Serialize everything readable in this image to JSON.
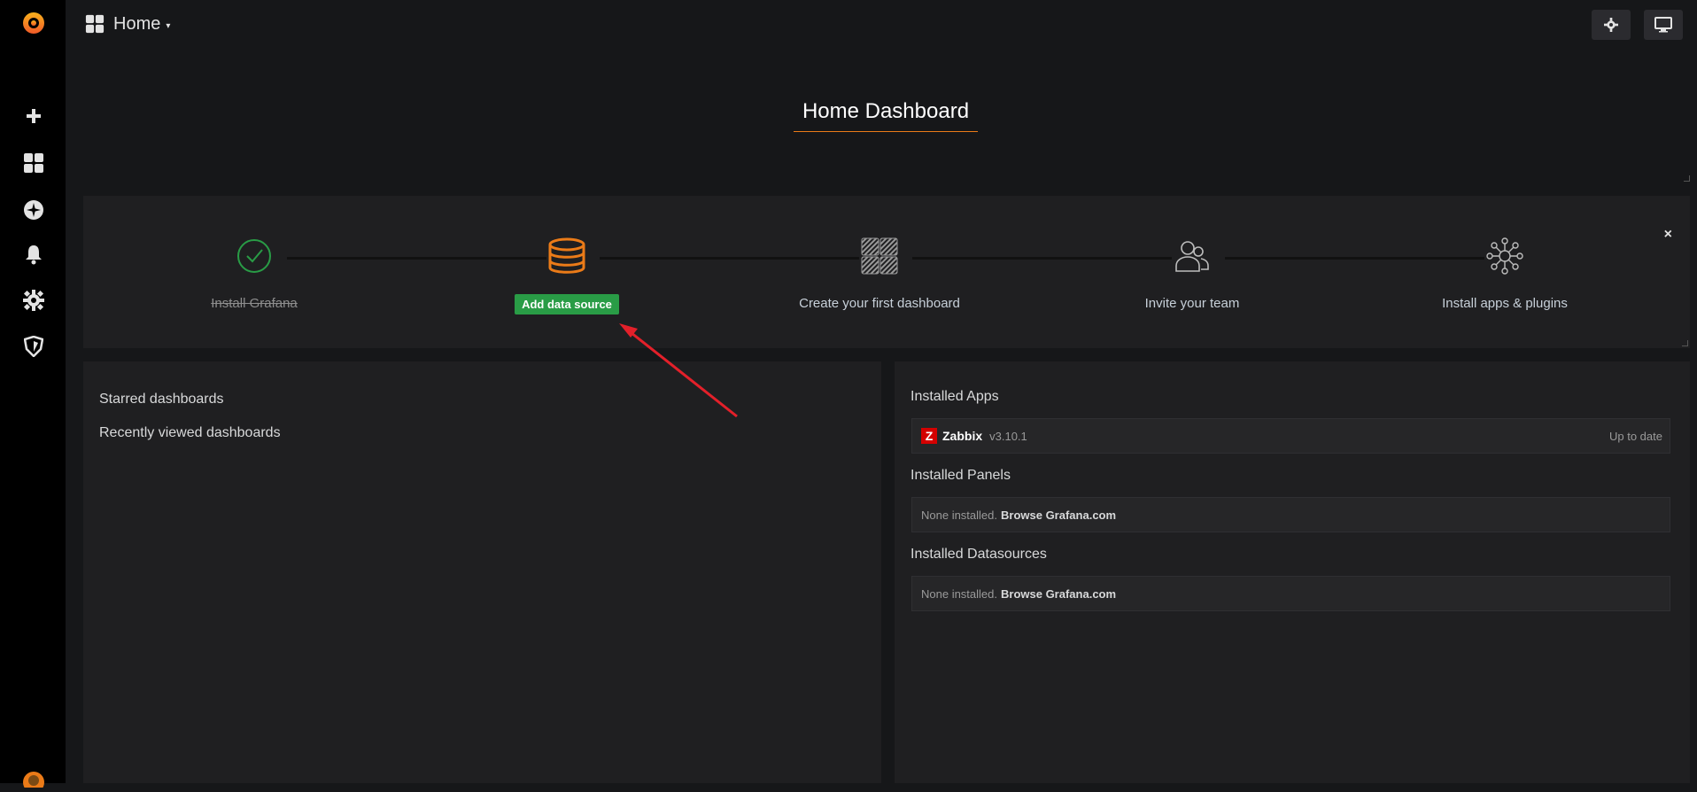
{
  "topbar": {
    "title": "Home",
    "caret": "▾"
  },
  "dashboard": {
    "title": "Home Dashboard"
  },
  "getting_started": {
    "close": "×",
    "steps": [
      {
        "label": "Install Grafana",
        "done": true
      },
      {
        "label": "Add data source",
        "is_button": true
      },
      {
        "label": "Create your first dashboard"
      },
      {
        "label": "Invite your team"
      },
      {
        "label": "Install apps & plugins"
      }
    ]
  },
  "left_panel": {
    "starred": "Starred dashboards",
    "recent": "Recently viewed dashboards"
  },
  "right_panel": {
    "apps_title": "Installed Apps",
    "app": {
      "badge": "Z",
      "name": "Zabbix",
      "version": "v3.10.1",
      "status": "Up to date"
    },
    "panels_title": "Installed Panels",
    "panels_none": "None installed.",
    "panels_link": "Browse Grafana.com",
    "datasources_title": "Installed Datasources",
    "ds_none": "None installed.",
    "ds_link": "Browse Grafana.com"
  },
  "colors": {
    "accent": "#eb7b18",
    "success": "#299c46",
    "annotation_arrow": "#e3202a"
  }
}
